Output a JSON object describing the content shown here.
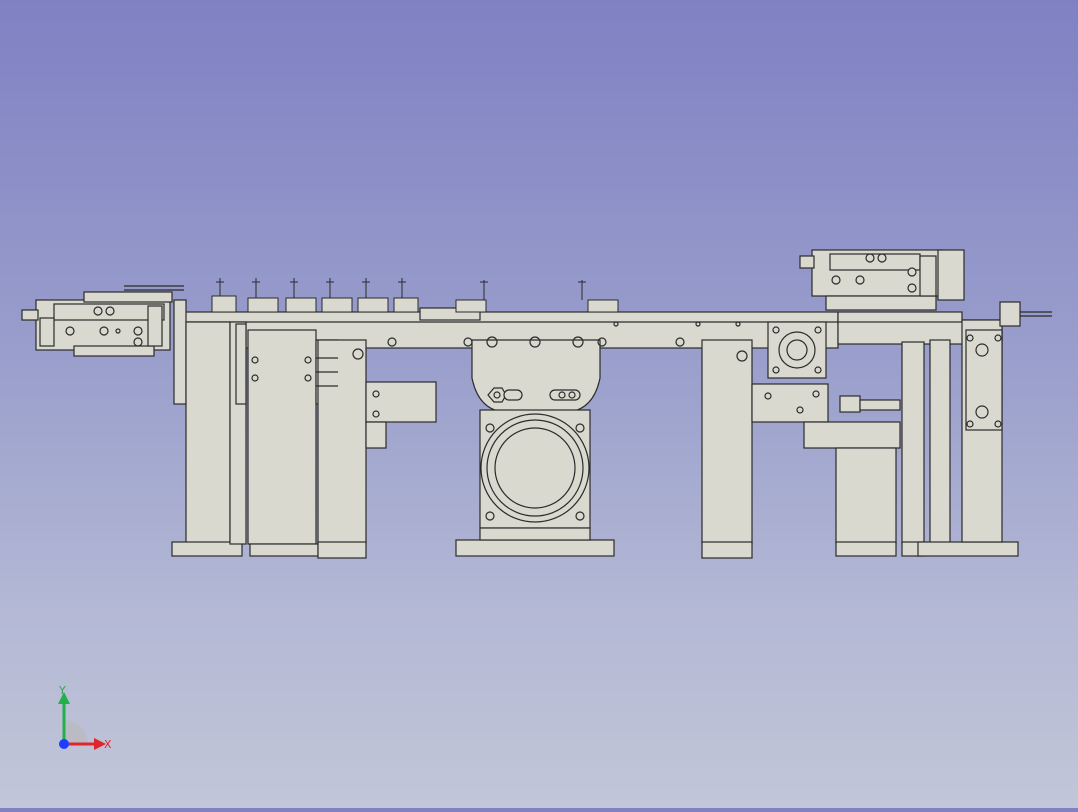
{
  "view": {
    "background_top": "#7f81c3",
    "background_bottom": "#c2c6d8",
    "part_fill": "#d9d9d0",
    "part_edge": "#2b2b2b"
  },
  "triad": {
    "x_label": "X",
    "y_label": "Y",
    "x_color": "#e0262b",
    "y_color": "#22b04a",
    "z_color": "#1e3cff"
  }
}
